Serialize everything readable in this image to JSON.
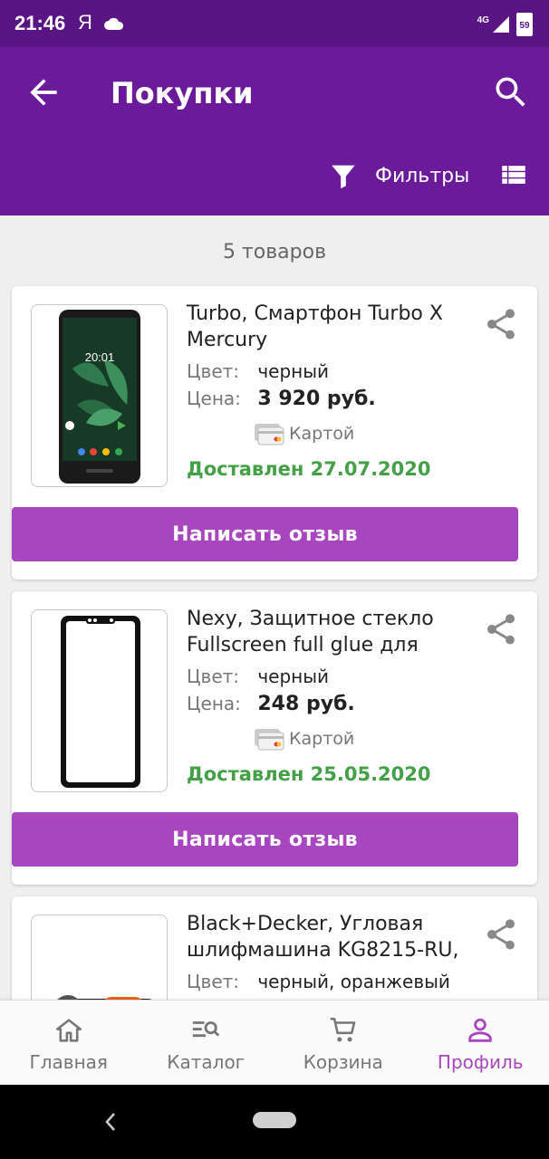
{
  "status_bar": {
    "time": "21:46",
    "extra": "Я",
    "network": "4G",
    "battery": "59"
  },
  "header": {
    "title": "Покупки",
    "filter_label": "Фильтры"
  },
  "count_text": "5 товаров",
  "labels": {
    "color": "Цвет:",
    "price": "Цена:"
  },
  "products": [
    {
      "name": "Turbo, Смартфон Turbo X Mercury",
      "color": "черный",
      "price": "3 920 руб.",
      "payment": "Картой",
      "status": "Доставлен 27.07.2020",
      "review_label": "Написать отзыв",
      "thumb_time": "20:01"
    },
    {
      "name": "Nexy, Защитное стекло Fullscreen full glue для",
      "color": "черный",
      "price": "248 руб.",
      "payment": "Картой",
      "status": "Доставлен 25.05.2020",
      "review_label": "Написать отзыв"
    },
    {
      "name": "Black+Decker, Угловая шлифмашина KG8215-RU,",
      "color": "черный, оранжевый"
    }
  ],
  "nav": [
    {
      "label": "Главная",
      "icon": "home-icon"
    },
    {
      "label": "Каталог",
      "icon": "catalog-search-icon"
    },
    {
      "label": "Корзина",
      "icon": "cart-icon"
    },
    {
      "label": "Профиль",
      "icon": "person-icon",
      "active": true
    }
  ],
  "colors": {
    "status_bar": "#5a1584",
    "app_bar": "#6b1b9a",
    "accent": "#a846bf",
    "delivered": "#43a047"
  }
}
